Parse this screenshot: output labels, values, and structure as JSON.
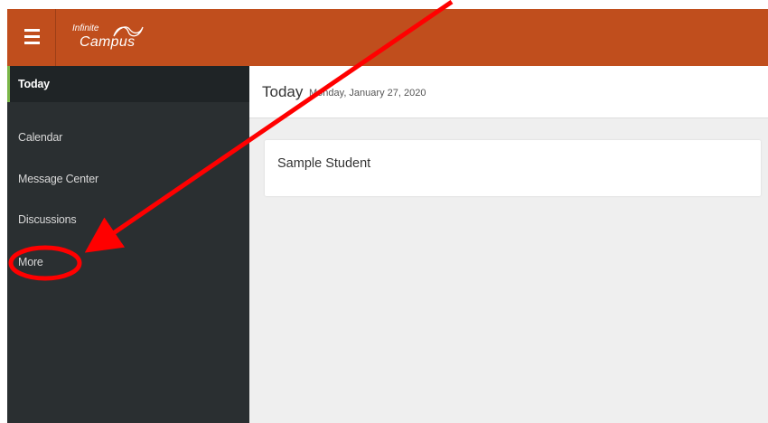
{
  "app": {
    "logo_line1": "Infinite",
    "logo_line2": "Campus"
  },
  "sidebar": {
    "items": [
      {
        "label": "Today",
        "active": true
      },
      {
        "label": "Calendar",
        "active": false
      },
      {
        "label": "Message Center",
        "active": false
      },
      {
        "label": "Discussions",
        "active": false
      },
      {
        "label": "More",
        "active": false
      }
    ]
  },
  "main": {
    "title": "Today",
    "date": "Monday, January 27, 2020",
    "cards": [
      {
        "title": "Sample Student"
      }
    ]
  },
  "colors": {
    "topbar": "#c04e1d",
    "sidebar": "#2a2f31",
    "active_indicator": "#7ab648",
    "annotation": "#ff0000"
  },
  "icons": [
    "hamburger-menu-icon",
    "infinite-campus-logo"
  ]
}
